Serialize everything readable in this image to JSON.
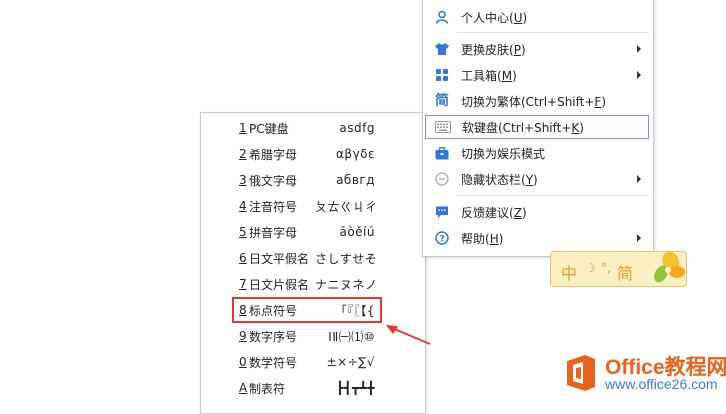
{
  "soft_keyboard_menu": {
    "items": [
      {
        "key": "1",
        "name": "PC键盘",
        "sample": "asdfg"
      },
      {
        "key": "2",
        "name": "希腊字母",
        "sample": "αβγδε"
      },
      {
        "key": "3",
        "name": "俄文字母",
        "sample": "абвгд"
      },
      {
        "key": "4",
        "name": "注音符号",
        "sample": "ㄆㄊㄍㄐㄔ"
      },
      {
        "key": "5",
        "name": "拼音字母",
        "sample": "āòěíú"
      },
      {
        "key": "6",
        "name": "日文平假名",
        "sample": "さしすせそ"
      },
      {
        "key": "7",
        "name": "日文片假名",
        "sample": "ナニヌネノ"
      },
      {
        "key": "8",
        "name": "标点符号",
        "sample": "「『〖【{"
      },
      {
        "key": "9",
        "name": "数字序号",
        "sample": "ⅠⅡ㈠⑴⑩"
      },
      {
        "key": "0",
        "name": "数学符号",
        "sample": "±×÷∑√"
      },
      {
        "key": "A",
        "name": "制表符",
        "sample": "┣┫┳┻╋"
      }
    ],
    "highlighted_item": "标点符号"
  },
  "context_menu": {
    "items": [
      {
        "icon": "user-icon",
        "glyph": "👤",
        "label": "个人中心",
        "hotkey": "U",
        "submenu": false
      },
      {
        "icon": "shirt-icon",
        "glyph": "👕",
        "label": "更换皮肤",
        "hotkey": "P",
        "submenu": true
      },
      {
        "icon": "toolbox-grid-icon",
        "glyph": "▦",
        "label": "工具箱",
        "hotkey": "M",
        "submenu": true
      },
      {
        "icon": "simplified-traditional-icon",
        "glyph": "简",
        "label": "切换为繁体(Ctrl+Shift+",
        "hotkey": "F",
        "submenu": false
      },
      {
        "icon": "keyboard-icon",
        "glyph": "⌨",
        "label": "软键盘(Ctrl+Shift+",
        "hotkey": "K",
        "submenu": false,
        "selected": true
      },
      {
        "icon": "briefcase-icon",
        "glyph": "💼",
        "label": "切换为娱乐模式",
        "hotkey": "",
        "submenu": false
      },
      {
        "icon": "minus-circle-icon",
        "glyph": "⊖",
        "label": "隐藏状态栏",
        "hotkey": "Y",
        "submenu": true
      },
      {
        "icon": "feedback-icon",
        "glyph": "💬",
        "label": "反馈建议",
        "hotkey": "Z",
        "submenu": false
      },
      {
        "icon": "help-icon",
        "glyph": "?",
        "label": "帮助",
        "hotkey": "H",
        "submenu": true
      }
    ]
  },
  "ime_status_bar": {
    "mode": "中",
    "moon": "☽",
    "punct": "°,",
    "script": "简"
  },
  "logo": {
    "name": "Office教程网",
    "url": "www.office26.com"
  },
  "colors": {
    "accent": "#2f7ad8",
    "highlight_red": "#e53935",
    "logo_orange": "#e8641c",
    "ime_yellow": "#fbf0c2"
  }
}
